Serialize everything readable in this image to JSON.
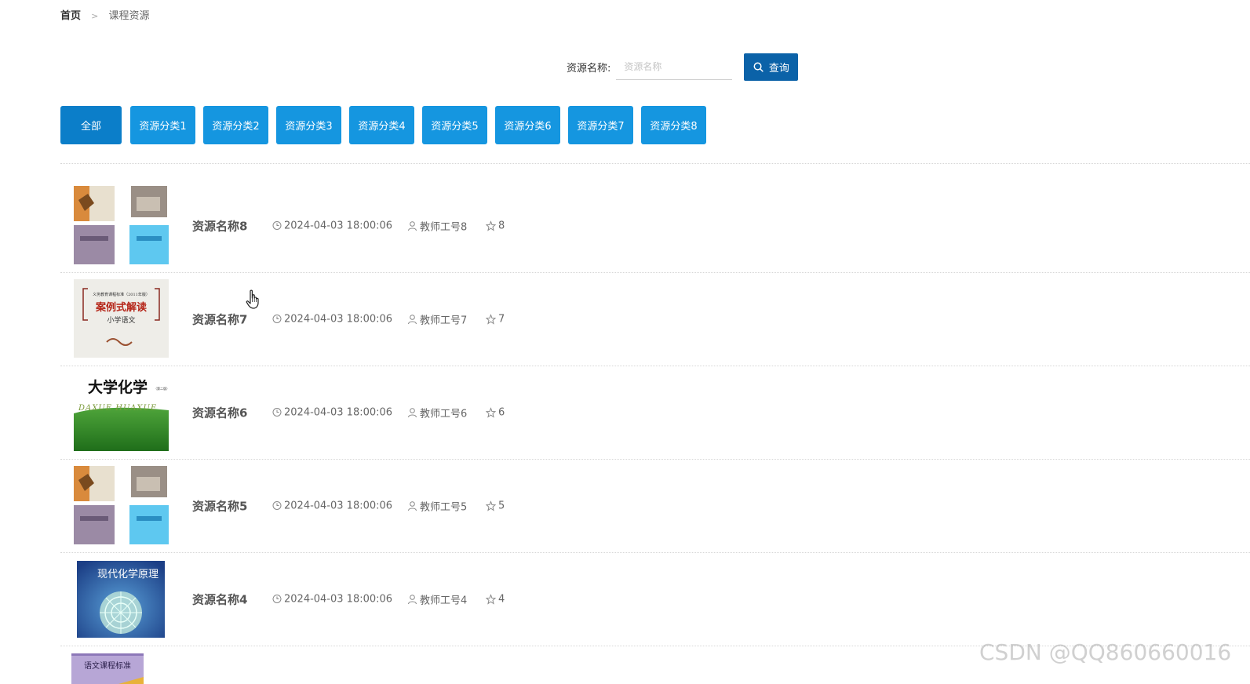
{
  "breadcrumb": {
    "home": "首页",
    "separator": ">",
    "current": "课程资源"
  },
  "search": {
    "label": "资源名称:",
    "placeholder": "资源名称",
    "value": "",
    "button_label": "查询"
  },
  "categories": [
    {
      "label": "全部",
      "active": true
    },
    {
      "label": "资源分类1"
    },
    {
      "label": "资源分类2"
    },
    {
      "label": "资源分类3"
    },
    {
      "label": "资源分类4"
    },
    {
      "label": "资源分类5"
    },
    {
      "label": "资源分类6"
    },
    {
      "label": "资源分类7"
    },
    {
      "label": "资源分类8"
    }
  ],
  "resources": [
    {
      "name": "资源名称8",
      "time": "2024-04-03 18:00:06",
      "teacher": "教师工号8",
      "likes": "8",
      "thumb": "collage"
    },
    {
      "name": "资源名称7",
      "time": "2024-04-03 18:00:06",
      "teacher": "教师工号7",
      "likes": "7",
      "thumb": "case-book",
      "thumb_text": {
        "top": "义务教育课程标准（2011年版）",
        "main": "案例式解读",
        "sub": "小学语文"
      }
    },
    {
      "name": "资源名称6",
      "time": "2024-04-03 18:00:06",
      "teacher": "教师工号6",
      "likes": "6",
      "thumb": "chem-book",
      "thumb_text": {
        "main": "大学化学",
        "edition": "（第二版）",
        "sub": "DAXUE HUAXUE"
      }
    },
    {
      "name": "资源名称5",
      "time": "2024-04-03 18:00:06",
      "teacher": "教师工号5",
      "likes": "5",
      "thumb": "collage"
    },
    {
      "name": "资源名称4",
      "time": "2024-04-03 18:00:06",
      "teacher": "教师工号4",
      "likes": "4",
      "thumb": "modern-chem-book",
      "thumb_text": {
        "main": "现代化学原理"
      }
    }
  ],
  "partial_item": {
    "thumb_text": "语文课程标准"
  },
  "watermark": "CSDN @QQ860660016",
  "colors": {
    "primary": "#1596e0",
    "active": "#0b7ec9",
    "search_button": "#0b62a8"
  },
  "icons": {
    "search": "search-icon",
    "time": "clock-icon",
    "teacher": "user-icon",
    "likes": "star-icon"
  }
}
